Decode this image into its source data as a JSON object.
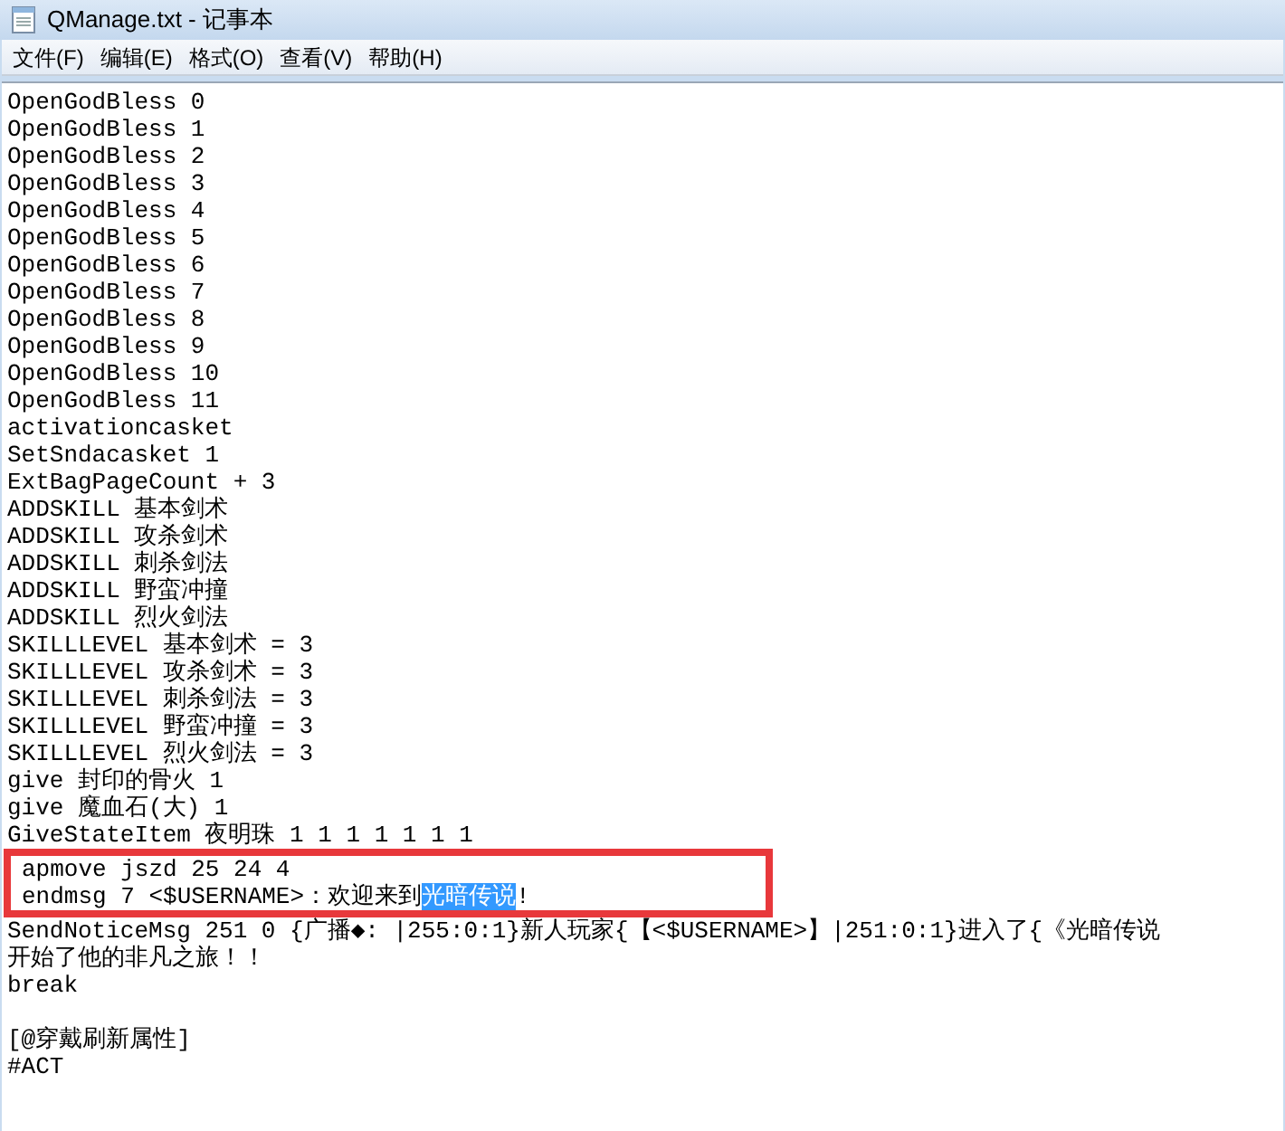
{
  "window": {
    "title": "QManage.txt - 记事本"
  },
  "menu": [
    "文件(F)",
    "编辑(E)",
    "格式(O)",
    "查看(V)",
    "帮助(H)"
  ],
  "blocks": [
    {
      "kind": "plain",
      "lines": [
        "OpenGodBless 0",
        "OpenGodBless 1",
        "OpenGodBless 2",
        "OpenGodBless 3",
        "OpenGodBless 4",
        "OpenGodBless 5",
        "OpenGodBless 6",
        "OpenGodBless 7",
        "OpenGodBless 8",
        "OpenGodBless 9",
        "OpenGodBless 10",
        "OpenGodBless 11",
        "activationcasket",
        "SetSndacasket 1",
        "ExtBagPageCount + 3",
        "ADDSKILL 基本剑术",
        "ADDSKILL 攻杀剑术",
        "ADDSKILL 刺杀剑法",
        "ADDSKILL 野蛮冲撞",
        "ADDSKILL 烈火剑法",
        "SKILLLEVEL 基本剑术 = 3",
        "SKILLLEVEL 攻杀剑术 = 3",
        "SKILLLEVEL 刺杀剑法 = 3",
        "SKILLLEVEL 野蛮冲撞 = 3",
        "SKILLLEVEL 烈火剑法 = 3",
        "give 封印的骨火 1",
        "give 魔血石(大) 1",
        "GiveStateItem 夜明珠 1 1 1 1 1 1 1"
      ]
    },
    {
      "kind": "boxed",
      "lines": [
        {
          "segments": [
            {
              "text": "apmove jszd 25 24 4",
              "selected": false
            }
          ]
        },
        {
          "segments": [
            {
              "text": "endmsg 7 <$USERNAME>：欢迎来到",
              "selected": false
            },
            {
              "text": "光暗传说",
              "selected": true
            },
            {
              "text": "!",
              "selected": false
            }
          ]
        }
      ]
    },
    {
      "kind": "plain",
      "lines": [
        "SendNoticeMsg 251 0 {广播◆: |255:0:1}新人玩家{【<$USERNAME>】|251:0:1}进入了{《光暗传说",
        "开始了他的非凡之旅！！",
        "break"
      ]
    },
    {
      "kind": "plain",
      "lines": [
        "[@穿戴刷新属性]",
        "#ACT"
      ]
    }
  ]
}
